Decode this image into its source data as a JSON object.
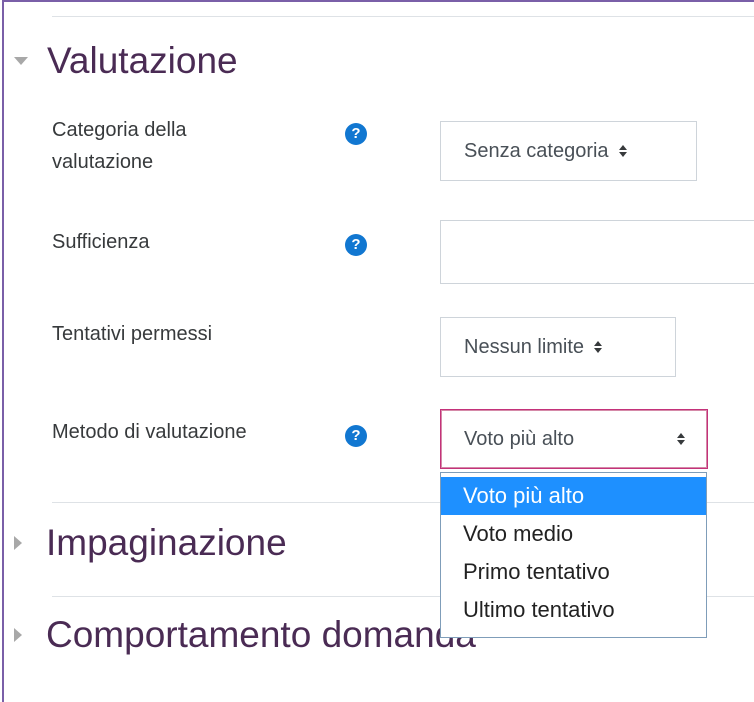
{
  "sections": {
    "valutazione": "Valutazione",
    "impaginazione": "Impaginazione",
    "comportamento": "Comportamento domanda"
  },
  "fields": {
    "categoria_label": "Categoria della valutazione",
    "categoria_value": "Senza categoria",
    "sufficienza_label": "Sufficienza",
    "sufficienza_value": "",
    "tentativi_label": "Tentativi permessi",
    "tentativi_value": "Nessun limite",
    "metodo_label": "Metodo di valutazione",
    "metodo_value": "Voto più alto"
  },
  "help_icon_glyph": "?",
  "dropdown": {
    "options": [
      "Voto più alto",
      "Voto medio",
      "Primo tentativo",
      "Ultimo tentativo"
    ],
    "selected_index": 0
  },
  "colors": {
    "section_title": "#4a2b54",
    "help_icon": "#1177d1",
    "focus_border": "#c4327a",
    "selected_option": "#1e90ff"
  }
}
